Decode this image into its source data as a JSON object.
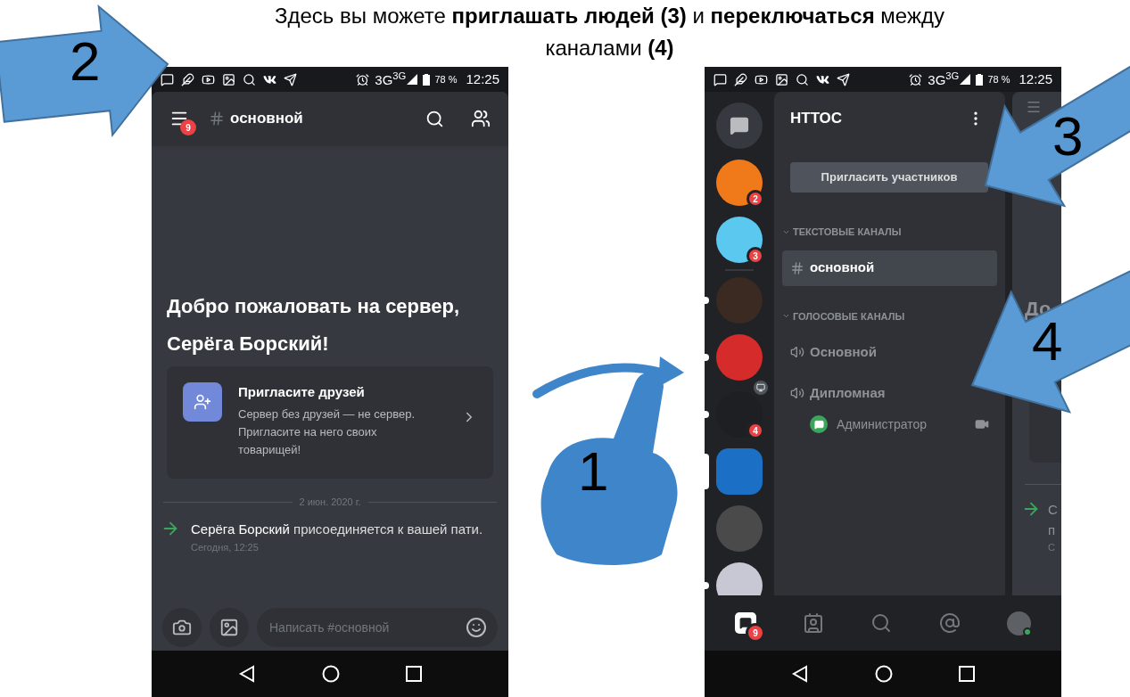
{
  "caption": {
    "lines": [
      "Здесь вы можете **приглашать людей (3)** и **переключаться** между",
      "каналами **(4)**"
    ]
  },
  "callouts": [
    {
      "kind": "arrow",
      "label": "2"
    },
    {
      "kind": "swipe",
      "label": "1"
    },
    {
      "kind": "arrow",
      "label": "3"
    },
    {
      "kind": "arrow",
      "label": "4"
    }
  ],
  "chat_screen": {
    "status_bar": {
      "network": "3G$^{3G}$",
      "battery": "78 %",
      "time": "12:25"
    },
    "channel": "основной",
    "menu_badge": "9",
    "welcome_title": [
      "Добро пожаловать на сервер,",
      "Серёга Борский!"
    ],
    "invite_card": {
      "title": "Пригласите друзей",
      "text": "Сервер без друзей — не сервер. Пригласите на него своих товарищей!"
    },
    "date_divider": "2 июн. 2020 г.",
    "message": {
      "text": "**Серёга Борский** присоединяется к вашей пати.",
      "time": "Сегодня, 12:25"
    },
    "composer": {
      "placeholder": "Написать #основной"
    }
  },
  "server_screen": {
    "status_bar": {
      "network": "3G$^{3G}$",
      "battery": "78 %",
      "time": "12:25"
    },
    "servers": [
      {
        "kind": "dm"
      },
      {
        "kind": "server",
        "color": "#f07a1a",
        "badge": "2",
        "unread": false,
        "selected": false,
        "streaming": false
      },
      {
        "kind": "server",
        "color": "#5bc8f0",
        "badge": "3",
        "unread": false,
        "selected": false,
        "streaming": false
      },
      {
        "kind": "divider"
      },
      {
        "kind": "server",
        "color": "#3a2a22",
        "unread": true,
        "selected": false,
        "streaming": false
      },
      {
        "kind": "server",
        "color": "#d52b2b",
        "unread": true,
        "selected": false,
        "streaming": false
      },
      {
        "kind": "server",
        "color": "#1e1f22",
        "badge": "4",
        "unread": true,
        "selected": false,
        "streaming": true
      },
      {
        "kind": "server",
        "color": "#1b6fc4",
        "unread": false,
        "selected": true,
        "streaming": false
      },
      {
        "kind": "server",
        "color": "#4a4a4a",
        "unread": false,
        "selected": false,
        "streaming": false
      },
      {
        "kind": "server",
        "color": "#c8c8d4",
        "unread": true,
        "selected": false,
        "streaming": false
      }
    ],
    "server_name": "НТТОС",
    "invite_button": "Пригласить участников",
    "categories": [
      {
        "name": "ТЕКСТОВЫЕ КАНАЛЫ",
        "channels": [
          {
            "kind": "text",
            "name": "основной",
            "selected": true
          }
        ]
      },
      {
        "name": "ГОЛОСОВЫЕ КАНАЛЫ",
        "channels": [
          {
            "kind": "voice",
            "name": "Основной",
            "selected": false
          },
          {
            "kind": "voice",
            "name": "Дипломная",
            "selected": false,
            "members": [
              {
                "name": "Администратор",
                "video": true
              }
            ]
          }
        ]
      }
    ],
    "peek": {
      "title": "До",
      "message_lines": [
        "С",
        "п",
        "С"
      ]
    },
    "tabs": [
      {
        "kind": "servers",
        "badge": "9",
        "selected": true
      },
      {
        "kind": "friends",
        "selected": false
      },
      {
        "kind": "search",
        "selected": false
      },
      {
        "kind": "mentions",
        "selected": false
      },
      {
        "kind": "profile",
        "selected": false
      }
    ]
  }
}
